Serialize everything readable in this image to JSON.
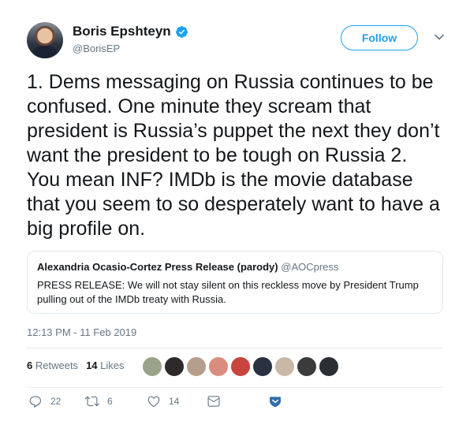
{
  "author": {
    "name": "Boris Epshteyn",
    "handle": "@BorisEP",
    "verified": true
  },
  "follow_label": "Follow",
  "tweet_text": "1. Dems messaging on Russia continues to be confused. One minute they scream that president is Russia’s puppet the next they don’t want the president to be tough on Russia 2. You mean INF? IMDb is the movie database that you seem to so desperately want to have a big profile on.",
  "quoted": {
    "name": "Alexandria Ocasio-Cortez Press Release (parody)",
    "handle": "@AOCpress",
    "text": "PRESS RELEASE: We will not stay silent on this reckless move by President Trump pulling out of the IMDb treaty with Russia."
  },
  "timestamp": "12:13 PM - 11 Feb 2019",
  "stats": {
    "retweets_count": "6",
    "retweets_label": "Retweets",
    "likes_count": "14",
    "likes_label": "Likes"
  },
  "liker_avatar_colors": [
    "#9aa38a",
    "#2f2a2a",
    "#b79e8a",
    "#d98d7f",
    "#c8453f",
    "#2a3140",
    "#c9b8a6",
    "#3b3b3b",
    "#2b2f33"
  ],
  "actions": {
    "reply_count": "22",
    "retweet_count": "6",
    "like_count": "14"
  },
  "colors": {
    "accent": "#1da1f2",
    "text": "#14171a",
    "muted": "#657786",
    "border": "#e1e8ed"
  }
}
